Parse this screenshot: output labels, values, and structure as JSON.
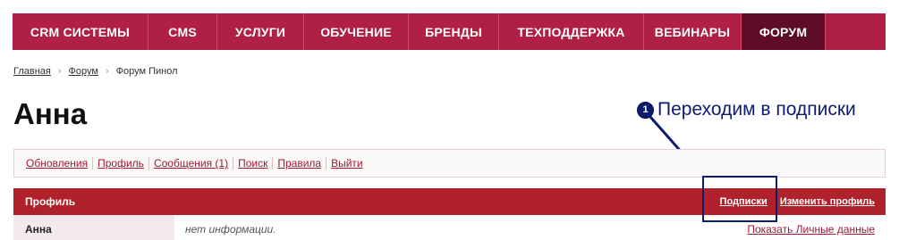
{
  "nav": {
    "items": [
      {
        "label": "CRM СИСТЕМЫ",
        "active": false
      },
      {
        "label": "CMS",
        "active": false
      },
      {
        "label": "УСЛУГИ",
        "active": false
      },
      {
        "label": "ОБУЧЕНИЕ",
        "active": false
      },
      {
        "label": "БРЕНДЫ",
        "active": false
      },
      {
        "label": "ТЕХПОДДЕРЖКА",
        "active": false
      },
      {
        "label": "ВЕБИНАРЫ",
        "active": false
      },
      {
        "label": "ФОРУМ",
        "active": true
      }
    ]
  },
  "breadcrumb": {
    "home": "Главная",
    "forum": "Форум",
    "current": "Форум Пинол",
    "separator": "›"
  },
  "page": {
    "title": "Анна"
  },
  "callout": {
    "number": "1",
    "text": "Переходим в подписки"
  },
  "submenu": {
    "links": [
      "Обновления",
      "Профиль",
      "Сообщения (1)",
      "Поиск",
      "Правила",
      "Выйти"
    ]
  },
  "profile": {
    "header": "Профиль",
    "subscriptions_link": "Подписки",
    "edit_link": "Изменить профиль",
    "row": {
      "name": "Анна",
      "info": "нет информации.",
      "show_link": "Показать Личные данные"
    }
  },
  "colors": {
    "nav_bg": "#b01f44",
    "nav_active": "#5e0c28",
    "profile_header": "#b0222b",
    "annotation": "#0b1c70",
    "link": "#a0183b"
  }
}
